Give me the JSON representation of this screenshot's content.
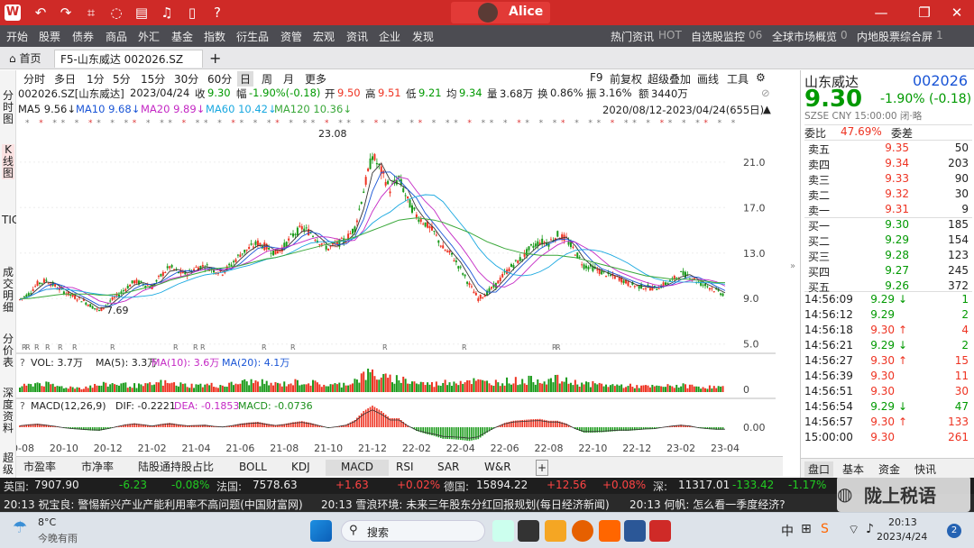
{
  "window": {
    "user": "Alice",
    "logo": "W"
  },
  "menu": [
    "开始",
    "股票",
    "债券",
    "商品",
    "外汇",
    "基金",
    "指数",
    "衍生品",
    "资管",
    "宏观",
    "资讯",
    "企业",
    "发现"
  ],
  "menu_right": [
    "热门资讯",
    "HOT",
    "自选股监控",
    "06",
    "全球市场概览",
    "0",
    "内地股票综合屏",
    "1"
  ],
  "tabs": {
    "home": "首页",
    "active": "F5-山东威达 002026.SZ"
  },
  "left_strip": [
    "分时图",
    "K线图",
    "TICK",
    "成交明细",
    "分价表",
    "深度资料",
    "超级"
  ],
  "periods": [
    "分时",
    "多日",
    "1分",
    "5分",
    "15分",
    "30分",
    "60分",
    "日",
    "周",
    "月",
    "更多"
  ],
  "active_period": "日",
  "tools": [
    "F9",
    "前复权",
    "超级叠加",
    "画线",
    "工具"
  ],
  "info": {
    "code": "002026.SZ[山东威达]",
    "date": "2023/04/24",
    "close_label": "收",
    "close": "9.30",
    "chg_label": "幅",
    "chg": "-1.90%(-0.18)",
    "open_label": "开",
    "open": "9.50",
    "high_label": "高",
    "high": "9.51",
    "low_label": "低",
    "low": "9.21",
    "avg_label": "均",
    "avg": "9.34",
    "vol_label": "量",
    "vol": "3.68万",
    "turn_label": "换",
    "turn": "0.86%",
    "amp_label": "振",
    "amp": "3.16%",
    "amt_label": "额",
    "amt": "3440万"
  },
  "ma": {
    "ma5": "MA5 9.56↓",
    "ma10": "MA10 9.68↓",
    "ma20": "MA20 9.89↓",
    "ma60": "MA60 10.42↓",
    "ma120": "MA120 10.36↓",
    "range": "2020/08/12-2023/04/24(655日)"
  },
  "vol_line": {
    "q": "?",
    "vol": "VOL: 3.7万",
    "ma5": "MA(5): 3.3万",
    "ma10": "MA(10): 3.6万",
    "ma20": "MA(20): 4.1万"
  },
  "macd_line": {
    "q": "?",
    "label": "MACD(12,26,9)",
    "dif": "DIF: -0.2221",
    "dea": "DEA: -0.1853",
    "macd": "MACD: -0.0736"
  },
  "bottom_tabs": [
    "市盈率",
    "市净率",
    "陆股通持股占比",
    "BOLL",
    "KDJ",
    "MACD",
    "RSI",
    "SAR",
    "W&R",
    "+"
  ],
  "active_bottom_tab": "MACD",
  "quote": {
    "name": "山东威达",
    "code": "002026",
    "price": "9.30",
    "chg": "-1.90% (-0.18)",
    "market": "SZSE  CNY  15:00:00  闭·略",
    "wb_label": "委比",
    "wb": "47.69%",
    "wc_label": "委差",
    "asks": [
      [
        "卖五",
        "9.35",
        "50"
      ],
      [
        "卖四",
        "9.34",
        "203"
      ],
      [
        "卖三",
        "9.33",
        "90"
      ],
      [
        "卖二",
        "9.32",
        "30"
      ],
      [
        "卖一",
        "9.31",
        "9"
      ]
    ],
    "bids": [
      [
        "买一",
        "9.30",
        "185"
      ],
      [
        "买二",
        "9.29",
        "154"
      ],
      [
        "买三",
        "9.28",
        "123"
      ],
      [
        "买四",
        "9.27",
        "245"
      ],
      [
        "买五",
        "9.26",
        "372"
      ]
    ],
    "ticks": [
      [
        "14:56:09",
        "9.29",
        "↓",
        "1"
      ],
      [
        "14:56:12",
        "9.29",
        "",
        "2"
      ],
      [
        "14:56:18",
        "9.30",
        "↑",
        "4"
      ],
      [
        "14:56:21",
        "9.29",
        "↓",
        "2"
      ],
      [
        "14:56:27",
        "9.30",
        "↑",
        "15"
      ],
      [
        "14:56:39",
        "9.30",
        "",
        "11"
      ],
      [
        "14:56:51",
        "9.30",
        "",
        "30"
      ],
      [
        "14:56:54",
        "9.29",
        "↓",
        "47"
      ],
      [
        "14:56:57",
        "9.30",
        "↑",
        "133"
      ],
      [
        "15:00:00",
        "9.30",
        "",
        "261"
      ]
    ],
    "tabs": [
      "盘口",
      "基本",
      "资金",
      "快讯"
    ]
  },
  "ticker": [
    "英国:",
    "7907.90",
    "-6.23",
    "-0.08%",
    "法国:",
    "7578.63",
    "+1.63",
    "+0.02%",
    "德国:",
    "15894.22",
    "+12.56",
    "+0.08%",
    "深:",
    "11317.01",
    "-133.42",
    "-1.17%"
  ],
  "news": [
    "20:13  祝宝良: 警惕新兴产业产能利用率不高问题(中国财富网)",
    "20:13  雪浪环境: 未来三年股东分红回报规划(每日经济新闻)",
    "20:13  何帆: 怎么看一季度经济?"
  ],
  "watermark": "陇上税语",
  "taskbar": {
    "temp": "8°C",
    "weather": "今晚有雨",
    "search": "搜索",
    "time": "20:13",
    "date": "2023/4/24",
    "badge": "2"
  },
  "colors": {
    "up": "#e32",
    "down": "#090",
    "ma5": "#333",
    "ma10": "#1a55d6",
    "ma20": "#c428c4",
    "ma60": "#19a8e0",
    "ma120": "#3aa83a"
  },
  "chart_data": {
    "type": "line",
    "title": "002026.SZ 山东威达 日K",
    "x_ticks": [
      "20-08",
      "20-10",
      "20-12",
      "21-02",
      "21-04",
      "21-06",
      "21-08",
      "21-10",
      "21-12",
      "22-02",
      "22-04",
      "22-06",
      "22-08",
      "22-10",
      "22-12",
      "23-02",
      "23-04"
    ],
    "y_ticks": [
      5.0,
      9.0,
      13.0,
      17.0,
      21.0
    ],
    "ylim": [
      4.5,
      24
    ],
    "annotations": {
      "max": "23.08",
      "min": "7.69"
    },
    "close": [
      8.9,
      9.4,
      10.3,
      10.6,
      10.1,
      9.6,
      9.2,
      8.9,
      8.4,
      7.9,
      8.6,
      9.2,
      9.9,
      10.5,
      10.3,
      10.0,
      11.0,
      11.8,
      11.3,
      11.2,
      11.7,
      11.9,
      11.5,
      11.3,
      12.0,
      12.9,
      13.4,
      13.9,
      13.5,
      13.0,
      13.6,
      14.6,
      15.2,
      14.8,
      14.0,
      13.4,
      13.8,
      14.2,
      15.2,
      18.5,
      21.6,
      20.2,
      18.6,
      19.6,
      17.6,
      16.3,
      15.6,
      14.8,
      13.4,
      12.8,
      11.6,
      10.2,
      9.0,
      9.5,
      10.2,
      11.2,
      12.0,
      12.6,
      13.5,
      14.0,
      13.9,
      14.6,
      14.2,
      13.1,
      11.9,
      11.7,
      11.3,
      11.0,
      10.8,
      10.3,
      10.1,
      10.0,
      9.9,
      10.2,
      10.6,
      11.2,
      11.0,
      10.4,
      10.1,
      9.7,
      9.3
    ],
    "ma_long": [
      9.0,
      9.0,
      9.1,
      9.2,
      9.3,
      9.4,
      9.4,
      9.4,
      9.4,
      9.3,
      9.3,
      9.4,
      9.5,
      9.7,
      9.9,
      10.1,
      10.3,
      10.6,
      10.8,
      11.0,
      11.2,
      11.4,
      11.6,
      11.7,
      11.8,
      11.9,
      12.1,
      12.3,
      12.5,
      12.6,
      12.8,
      13.0,
      13.2,
      13.4,
      13.6,
      13.8,
      14.0,
      14.2,
      14.4,
      14.7,
      15.0,
      15.3,
      15.6,
      15.9,
      16.0,
      16.1,
      16.0,
      15.9,
      15.7,
      15.4,
      15.1,
      14.8,
      14.4,
      14.0,
      13.7,
      13.4,
      13.2,
      13.0,
      12.9,
      12.8,
      12.8,
      12.8,
      12.7,
      12.6,
      12.4,
      12.2,
      12.0,
      11.8,
      11.6,
      11.4,
      11.2,
      11.0,
      10.9,
      10.8,
      10.7,
      10.7,
      10.7,
      10.6,
      10.5,
      10.4,
      10.4
    ],
    "volume": [
      30,
      40,
      55,
      45,
      35,
      30,
      28,
      25,
      35,
      40,
      45,
      50,
      42,
      38,
      36,
      45,
      55,
      50,
      45,
      40,
      38,
      42,
      40,
      38,
      45,
      55,
      60,
      58,
      50,
      45,
      48,
      55,
      60,
      55,
      45,
      40,
      42,
      48,
      70,
      95,
      110,
      85,
      75,
      80,
      65,
      55,
      50,
      45,
      55,
      60,
      65,
      70,
      60,
      55,
      58,
      62,
      66,
      64,
      70,
      72,
      68,
      74,
      62,
      55,
      50,
      46,
      42,
      40,
      38,
      36,
      34,
      32,
      31,
      33,
      36,
      38,
      35,
      32,
      30,
      29,
      28
    ],
    "macd": [
      0.05,
      0.08,
      0.1,
      0.07,
      0.03,
      -0.02,
      -0.05,
      -0.07,
      -0.09,
      -0.1,
      -0.05,
      0.02,
      0.08,
      0.11,
      0.08,
      0.04,
      0.09,
      0.12,
      0.08,
      0.05,
      0.06,
      0.07,
      0.03,
      0.01,
      0.05,
      0.1,
      0.13,
      0.15,
      0.1,
      0.06,
      0.09,
      0.14,
      0.17,
      0.12,
      0.05,
      -0.02,
      0.02,
      0.07,
      0.2,
      0.45,
      0.6,
      0.45,
      0.25,
      0.25,
      0.05,
      -0.1,
      -0.18,
      -0.24,
      -0.32,
      -0.33,
      -0.35,
      -0.38,
      -0.33,
      -0.15,
      0.0,
      0.12,
      0.18,
      0.2,
      0.22,
      0.23,
      0.18,
      0.18,
      0.1,
      -0.05,
      -0.15,
      -0.15,
      -0.14,
      -0.12,
      -0.1,
      -0.1,
      -0.08,
      -0.06,
      -0.05,
      0.0,
      0.04,
      0.07,
      0.04,
      -0.02,
      -0.05,
      -0.07,
      -0.07
    ]
  }
}
